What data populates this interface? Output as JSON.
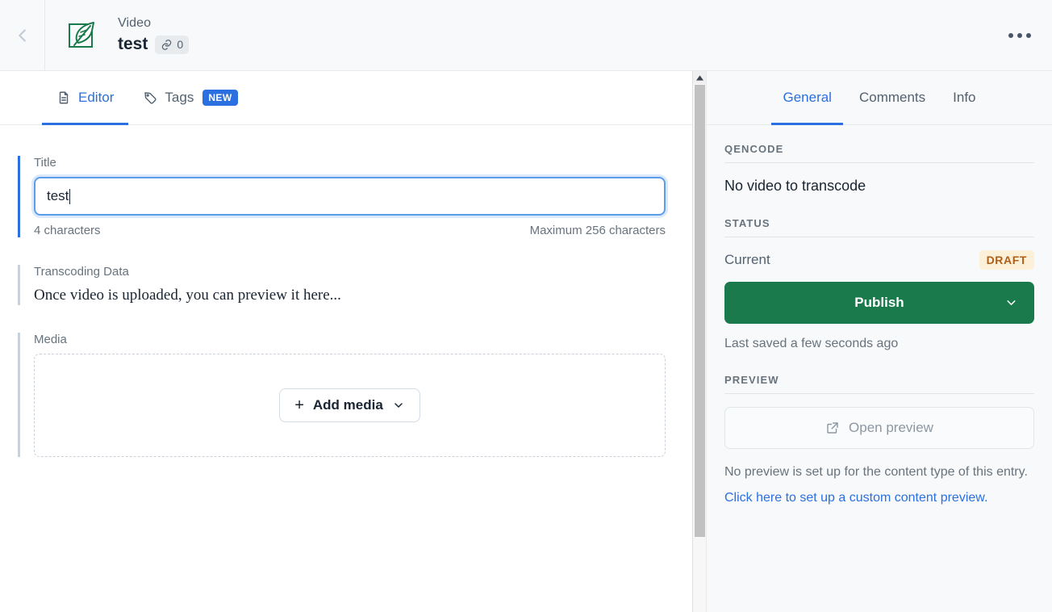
{
  "header": {
    "back_icon": "chevron-left-icon",
    "entry_type_icon": "feather-square-icon",
    "content_type": "Video",
    "title": "test",
    "link_badge_icon": "link-icon",
    "link_badge_count": "0",
    "more_actions_icon": "kebab-menu-icon"
  },
  "tabs": [
    {
      "label": "Editor",
      "icon": "document-icon",
      "active": true
    },
    {
      "label": "Tags",
      "icon": "tag-icon",
      "badge": "NEW",
      "active": false
    }
  ],
  "editor": {
    "title_field": {
      "label": "Title",
      "value": "test",
      "char_count": "4 characters",
      "max_hint": "Maximum 256 characters"
    },
    "transcoding_field": {
      "label": "Transcoding Data",
      "value": "Once video is uploaded, you can preview it here..."
    },
    "media_field": {
      "label": "Media",
      "add_button": "Add media",
      "add_icon": "plus-icon",
      "dropdown_icon": "chevron-down-icon"
    }
  },
  "sidebar": {
    "tabs": [
      {
        "label": "General",
        "active": true
      },
      {
        "label": "Comments",
        "active": false
      },
      {
        "label": "Info",
        "active": false
      }
    ],
    "qencode": {
      "heading": "QENCODE",
      "message": "No video to transcode"
    },
    "status": {
      "heading": "STATUS",
      "current_label": "Current",
      "current_value": "DRAFT",
      "publish_label": "Publish",
      "publish_dropdown_icon": "chevron-down-icon",
      "saved_note": "Last saved a few seconds ago"
    },
    "preview": {
      "heading": "PREVIEW",
      "open_label": "Open preview",
      "open_icon": "external-link-icon",
      "note": "No preview is set up for the content type of this entry.",
      "link": "Click here to set up a custom content preview."
    }
  },
  "colors": {
    "accent_blue": "#2b6fe0",
    "brand_green": "#1a7a4c",
    "draft_badge_bg": "#fdf0d9",
    "draft_badge_text": "#ad5f18",
    "sidebar_bg": "#f7f9fa"
  },
  "scrollbar": {
    "up_arrow_icon": "caret-up-icon"
  }
}
